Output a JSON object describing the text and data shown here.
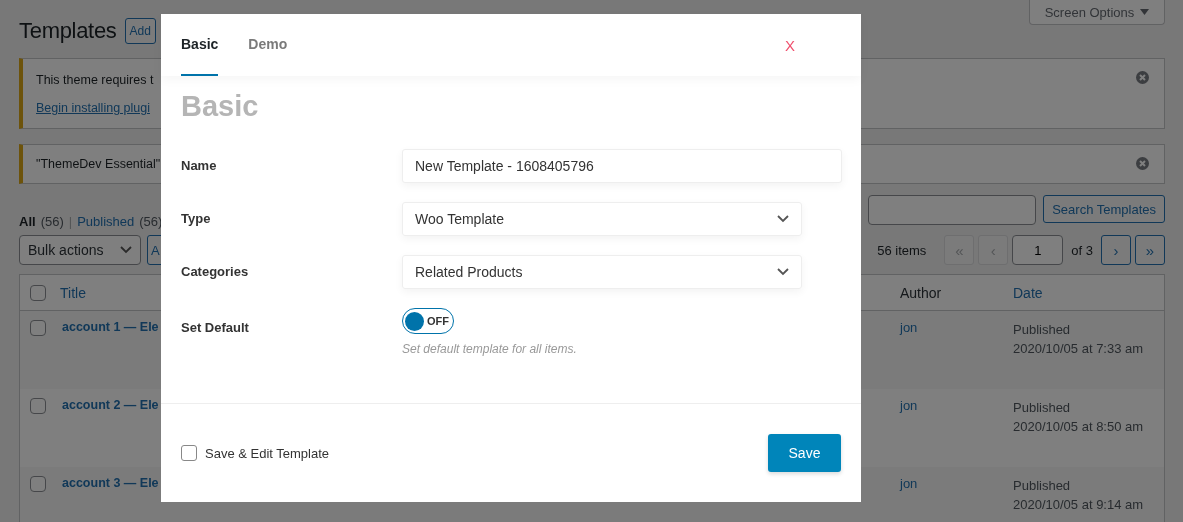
{
  "page": {
    "title": "Templates",
    "add_button": "Add",
    "screen_options": "Screen Options"
  },
  "notices": [
    {
      "text": "This theme requires t",
      "link": "Begin installing plugi"
    },
    {
      "text": "\"ThemeDev Essential\""
    }
  ],
  "filters": [
    {
      "label": "All",
      "count": "(56)",
      "selected": true
    },
    {
      "label": "Published",
      "count": "(56)",
      "selected": false
    }
  ],
  "filter_separator": "|",
  "bulk_actions": "Bulk actions",
  "apply_button": "A",
  "search_button": "Search Templates",
  "pagination": {
    "items": "56 items",
    "buttons": [
      {
        "label": "«",
        "disabled": true
      },
      {
        "label": "‹",
        "disabled": true
      }
    ],
    "page": "1",
    "of": "of 3",
    "next_buttons": [
      {
        "label": "›",
        "disabled": false
      },
      {
        "label": "»",
        "disabled": false
      }
    ]
  },
  "table": {
    "all_checked": false,
    "columns": [
      {
        "label": "Title",
        "sortable": true
      },
      {
        "label": "Author",
        "sortable": false
      },
      {
        "label": "Date",
        "sortable": true
      }
    ],
    "rows": [
      {
        "checked": false,
        "title": "account 1 — Ele",
        "author": "jon",
        "status": "Published",
        "date": "2020/10/05 at 7:33 am"
      },
      {
        "checked": false,
        "title": "account 2 — Ele",
        "author": "jon",
        "status": "Published",
        "date": "2020/10/05 at 8:50 am"
      },
      {
        "checked": false,
        "title": "account 3 — Ele",
        "author": "jon",
        "status": "Published",
        "date": "2020/10/05 at 9:14 am"
      }
    ]
  },
  "modal": {
    "tabs": [
      {
        "label": "Basic",
        "selected": true
      },
      {
        "label": "Demo",
        "selected": false
      }
    ],
    "close": "X",
    "heading": "Basic",
    "fields": [
      {
        "kind": "text",
        "label": "Name",
        "value": "New Template - 1608405796"
      },
      {
        "kind": "select",
        "label": "Type",
        "value": "Woo Template"
      },
      {
        "kind": "select",
        "label": "Categories",
        "value": "Related Products"
      },
      {
        "kind": "toggle",
        "label": "Set Default",
        "on": false,
        "state_label": "OFF",
        "help": "Set default template for all items."
      }
    ],
    "footer": {
      "checkbox_label": "Save & Edit Template",
      "checked": false,
      "save": "Save"
    }
  }
}
